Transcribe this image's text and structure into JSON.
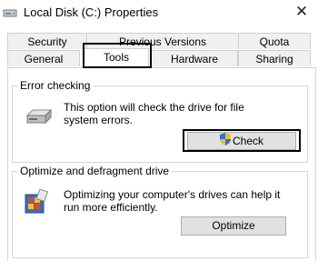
{
  "window": {
    "title": "Local Disk (C:) Properties",
    "close_glyph": "✕",
    "icon": "drive-icon"
  },
  "tabs": {
    "back_row": [
      {
        "label": "Security"
      },
      {
        "label": "Previous Versions"
      },
      {
        "label": "Quota"
      }
    ],
    "front_row": [
      {
        "label": "General"
      },
      {
        "label": "Tools"
      },
      {
        "label": "Hardware"
      },
      {
        "label": "Sharing"
      }
    ],
    "active": "Tools"
  },
  "error_checking": {
    "group_label": "Error checking",
    "description": "This option will check the drive for file system errors.",
    "button_label": "Check",
    "icon": "hard-drive-icon",
    "button_icon": "shield-icon"
  },
  "optimize": {
    "group_label": "Optimize and defragment drive",
    "description": "Optimizing your computer's drives can help it run more efficiently.",
    "button_label": "Optimize",
    "icon": "defragment-icon"
  },
  "colors": {
    "button_bg": "#e1e1e1",
    "tab_bg": "#f0f0f0",
    "highlight_outline": "#000000"
  }
}
